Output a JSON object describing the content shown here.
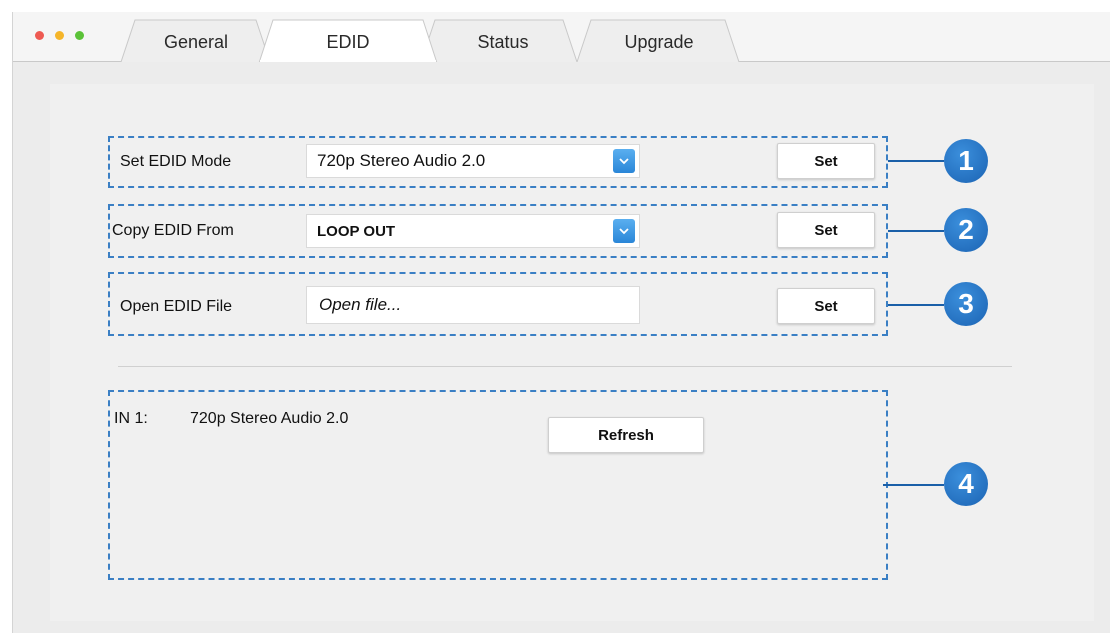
{
  "window": {
    "traffic_lights": [
      {
        "name": "close",
        "color": "#ee5a52"
      },
      {
        "name": "minimize",
        "color": "#f5b529"
      },
      {
        "name": "zoom",
        "color": "#5bc238"
      }
    ]
  },
  "tabs": [
    {
      "label": "General",
      "active": false
    },
    {
      "label": "EDID",
      "active": true
    },
    {
      "label": "Status",
      "active": false
    },
    {
      "label": "Upgrade",
      "active": false
    }
  ],
  "edid": {
    "mode": {
      "label": "Set EDID Mode",
      "value": "720p Stereo Audio 2.0",
      "button": "Set",
      "callout": "1"
    },
    "copy": {
      "label": "Copy EDID From",
      "value": "LOOP OUT",
      "button": "Set",
      "callout": "2"
    },
    "file": {
      "label": "Open EDID File",
      "placeholder": "Open file...",
      "button": "Set",
      "callout": "3"
    }
  },
  "status": {
    "input_label": "IN 1:",
    "input_value": "720p Stereo Audio 2.0",
    "refresh_button": "Refresh",
    "callout": "4"
  },
  "colors": {
    "accent": "#1b63b3",
    "dashed_border": "#3a7fc4",
    "dropdown_arrow": "#2a86d8"
  }
}
